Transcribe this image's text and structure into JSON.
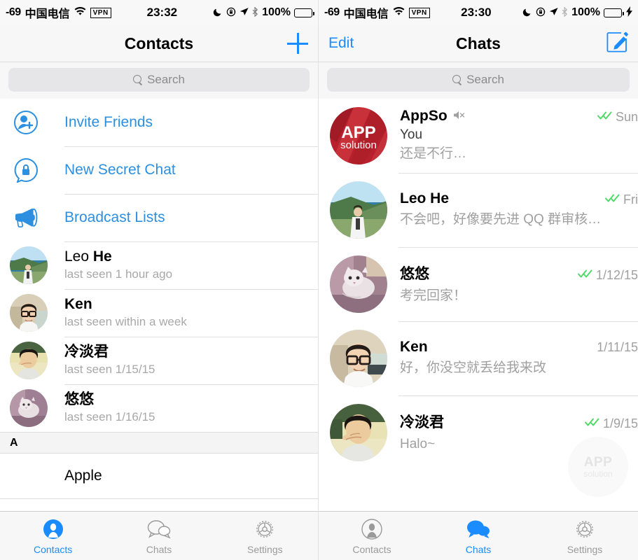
{
  "left": {
    "statusbar": {
      "rssi": "-69",
      "carrier": "中国电信",
      "wifi_icon": "wifi-icon",
      "vpn": "VPN",
      "time": "23:32",
      "moon_icon": "do-not-disturb-moon-icon",
      "lock_icon": "rotation-lock-icon",
      "location_icon": "location-arrow-icon",
      "bluetooth_icon": "bluetooth-icon",
      "battery_pct": "100%",
      "battery_state": "full",
      "charging": false
    },
    "navbar": {
      "title": "Contacts",
      "right_icon": "plus-icon"
    },
    "search": {
      "placeholder": "Search",
      "icon": "search-icon"
    },
    "actions": [
      {
        "label": "Invite Friends",
        "icon": "add-person-icon"
      },
      {
        "label": "New Secret Chat",
        "icon": "lock-bubble-icon"
      },
      {
        "label": "Broadcast Lists",
        "icon": "megaphone-icon"
      }
    ],
    "contacts": [
      {
        "first": "Leo ",
        "last": "He",
        "bold_last": true,
        "status": "last seen 1 hour ago",
        "avatar": "beach"
      },
      {
        "first": "Ken",
        "last": "",
        "bold_last": false,
        "status": "last seen within a week",
        "avatar": "glasses"
      },
      {
        "first": "冷淡君",
        "last": "",
        "bold_last": false,
        "status": "last seen 1/15/15",
        "avatar": "facepalm"
      },
      {
        "first": "悠悠",
        "last": "",
        "bold_last": false,
        "status": "last seen 1/16/15",
        "avatar": "cat"
      }
    ],
    "section": {
      "letter": "A"
    },
    "section_rows": [
      {
        "name": "Apple"
      }
    ],
    "tabs": [
      {
        "label": "Contacts",
        "icon": "person-filled-icon",
        "active": true
      },
      {
        "label": "Chats",
        "icon": "chat-bubbles-icon",
        "active": false
      },
      {
        "label": "Settings",
        "icon": "gear-icon",
        "active": false
      }
    ]
  },
  "right": {
    "statusbar": {
      "rssi": "-69",
      "carrier": "中国电信",
      "wifi_icon": "wifi-icon",
      "vpn": "VPN",
      "time": "23:30",
      "moon_icon": "do-not-disturb-moon-icon",
      "lock_icon": "rotation-lock-icon",
      "location_icon": "location-arrow-icon",
      "bluetooth_icon": "bluetooth-icon",
      "battery_pct": "100%",
      "battery_state": "charging",
      "charging": true
    },
    "navbar": {
      "left_label": "Edit",
      "title": "Chats",
      "right_icon": "compose-icon"
    },
    "search": {
      "placeholder": "Search",
      "icon": "search-icon"
    },
    "chats": [
      {
        "name": "AppSo",
        "muted": true,
        "avatar": "appso",
        "prefix": "You",
        "message": "还是不行…",
        "date": "Sun",
        "read_ticks": true
      },
      {
        "name": "Leo He",
        "muted": false,
        "avatar": "beach",
        "prefix": "",
        "message": "不会吧，好像要先进 QQ 群审核…",
        "date": "Fri",
        "read_ticks": true
      },
      {
        "name": "悠悠",
        "muted": false,
        "avatar": "cat",
        "prefix": "",
        "message": "考完回家！",
        "date": "1/12/15",
        "read_ticks": true
      },
      {
        "name": "Ken",
        "muted": false,
        "avatar": "glasses",
        "prefix": "",
        "message": "好，你没空就丢给我来改",
        "date": "1/11/15",
        "read_ticks": false
      },
      {
        "name": "冷淡君",
        "muted": false,
        "avatar": "facepalm",
        "prefix": "",
        "message": "Halo~",
        "date": "1/9/15",
        "read_ticks": true
      }
    ],
    "watermark": {
      "line1": "APP",
      "line2": "solution"
    },
    "tabs": [
      {
        "label": "Contacts",
        "icon": "person-outline-icon",
        "active": false
      },
      {
        "label": "Chats",
        "icon": "chat-bubbles-filled-icon",
        "active": true
      },
      {
        "label": "Settings",
        "icon": "gear-icon",
        "active": false
      }
    ]
  },
  "colors": {
    "accent_blue": "#1a8cff",
    "link_blue": "#2c8fe0",
    "tick_green": "#4cd964",
    "appso_red": "#b7202c",
    "muted_gray": "#a0a0a0"
  }
}
